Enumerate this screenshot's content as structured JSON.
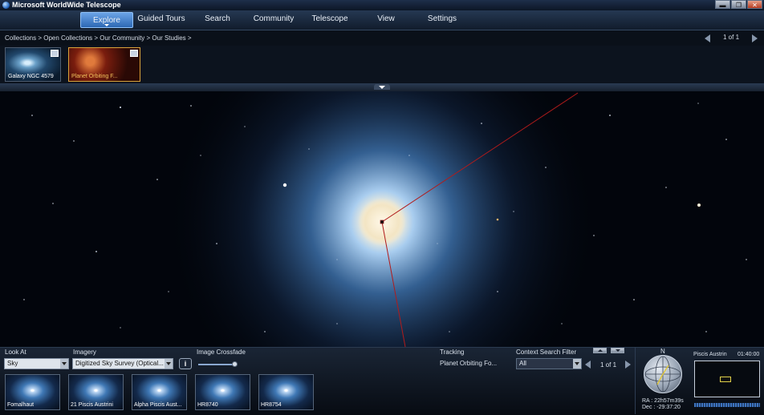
{
  "app": {
    "title": "Microsoft WorldWide Telescope"
  },
  "window_controls": {
    "minimize": "▬",
    "restore": "❐",
    "close": "✕"
  },
  "menu": [
    {
      "label": "Explore",
      "active": true
    },
    {
      "label": "Guided Tours"
    },
    {
      "label": "Search"
    },
    {
      "label": "Community"
    },
    {
      "label": "Telescope"
    },
    {
      "label": "View"
    },
    {
      "label": "Settings"
    }
  ],
  "breadcrumb": "Collections  >  Open Collections  >  Our Community  >  Our Studies  >",
  "collection_pager": {
    "text": "1 of 1"
  },
  "collection_thumbs": [
    {
      "label": "Galaxy NGC 4579"
    },
    {
      "label": "Planet Orbiting F...",
      "selected": true
    }
  ],
  "bottom": {
    "look_at": {
      "label": "Look At",
      "value": "Sky"
    },
    "imagery": {
      "label": "Imagery",
      "value": "Digitized Sky Survey (Optical..."
    },
    "info_button": "i",
    "crossfade": {
      "label": "Image Crossfade",
      "value": 0.95
    },
    "tracking": {
      "label": "Tracking",
      "value": "Planet Orbiting Fo..."
    },
    "context_filter": {
      "label": "Context Search Filter",
      "value": "All"
    },
    "context_pager": {
      "text": "1 of 1"
    },
    "context_thumbs": [
      {
        "label": "Fomalhaut"
      },
      {
        "label": "21 Piscis Austrini"
      },
      {
        "label": "Alpha Piscis Aust..."
      },
      {
        "label": "HR8740"
      },
      {
        "label": "HR8754"
      }
    ]
  },
  "navigator": {
    "north": "N",
    "ra": "RA :  22h57m39s",
    "dec": "Dec :  -29:37:20",
    "constellation": "Piscis Austrin",
    "time": "01:40:00"
  }
}
